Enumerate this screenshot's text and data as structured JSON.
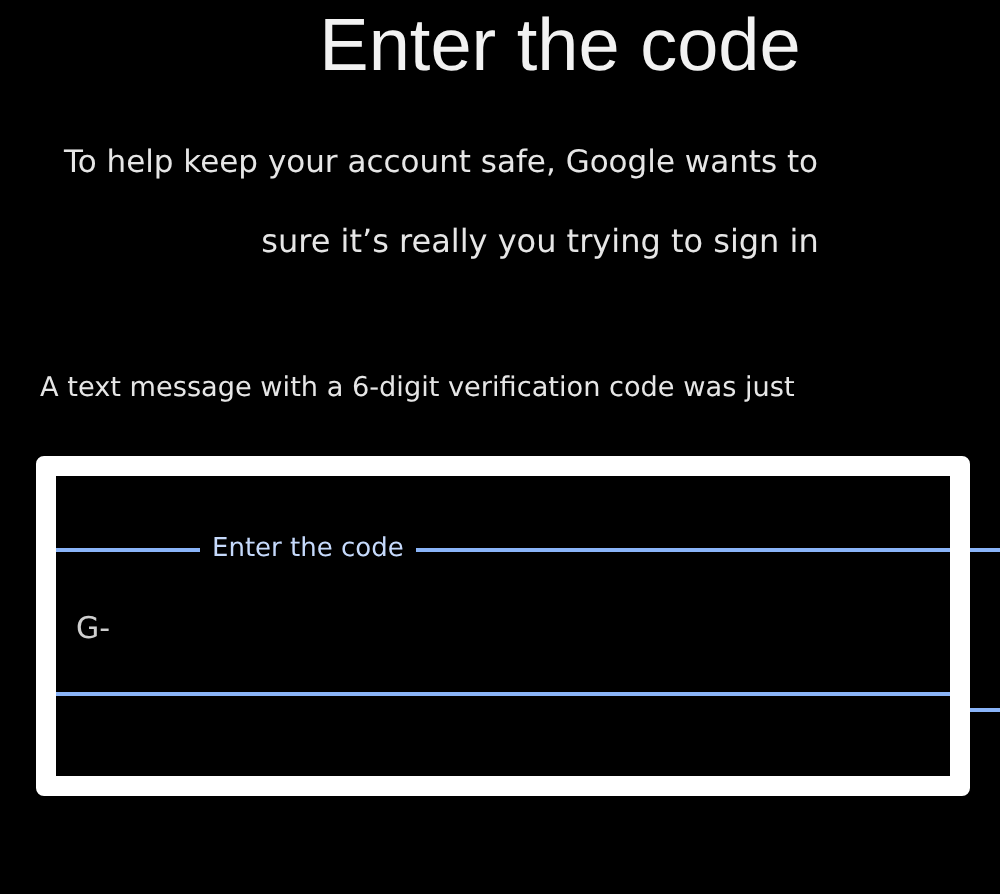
{
  "title": "Enter the code",
  "subtitle_lines": [
    "To help keep your account safe, Google wants to",
    "sure it’s really you trying to sign in"
  ],
  "message": "A text message with a 6-digit verification code was just",
  "code_field": {
    "label": "Enter the code",
    "value": "G-"
  }
}
